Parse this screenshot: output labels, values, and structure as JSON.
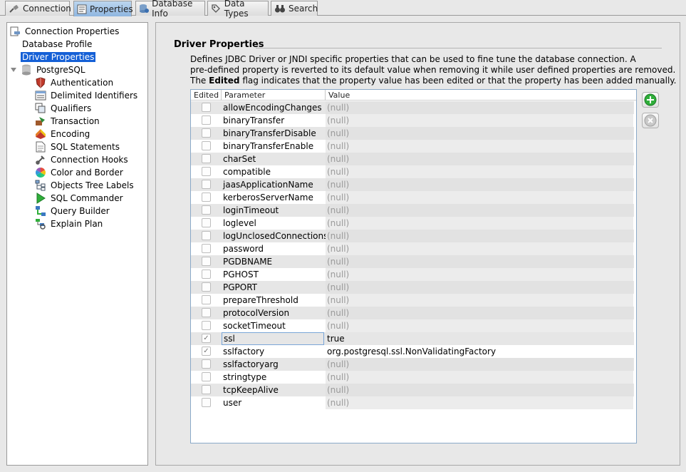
{
  "tabs": [
    {
      "label": "Connection",
      "icon": "plug-icon"
    },
    {
      "label": "Properties",
      "icon": "properties-icon"
    },
    {
      "label": "Database Info",
      "icon": "database-info-icon"
    },
    {
      "label": "Data Types",
      "icon": "data-types-icon"
    },
    {
      "label": "Search",
      "icon": "binoculars-icon"
    }
  ],
  "tree": {
    "root": "Connection Properties",
    "items": [
      {
        "label": "Database Profile"
      },
      {
        "label": "Driver Properties"
      },
      {
        "label": "PostgreSQL"
      },
      {
        "label": "Authentication",
        "icon": "shield-icon"
      },
      {
        "label": "Delimited Identifiers",
        "icon": "identifiers-icon"
      },
      {
        "label": "Qualifiers",
        "icon": "qualifiers-icon"
      },
      {
        "label": "Transaction",
        "icon": "transaction-icon"
      },
      {
        "label": "Encoding",
        "icon": "encoding-icon"
      },
      {
        "label": "SQL Statements",
        "icon": "document-icon"
      },
      {
        "label": "Connection Hooks",
        "icon": "hook-icon"
      },
      {
        "label": "Color and Border",
        "icon": "color-wheel-icon"
      },
      {
        "label": "Objects Tree Labels",
        "icon": "tree-labels-icon"
      },
      {
        "label": "SQL Commander",
        "icon": "play-icon"
      },
      {
        "label": "Query Builder",
        "icon": "query-builder-icon"
      },
      {
        "label": "Explain Plan",
        "icon": "explain-plan-icon"
      }
    ]
  },
  "section": {
    "title": "Driver Properties",
    "desc_line1": "Defines JDBC Driver or JNDI specific properties that can be used to fine tune the database connection. A",
    "desc_line2": "pre-defined property is reverted to its default value when removing it while user defined properties are removed.",
    "desc_line3_pre": "The ",
    "desc_line3_bold": "Edited",
    "desc_line3_post": " flag indicates that the property value has been edited or that the property has been added manually."
  },
  "table": {
    "headers": {
      "edited": "Edited",
      "parameter": "Parameter",
      "value": "Value"
    },
    "rows": [
      {
        "param": "allowEncodingChanges",
        "value": "(null)",
        "edited": false
      },
      {
        "param": "binaryTransfer",
        "value": "(null)",
        "edited": false
      },
      {
        "param": "binaryTransferDisable",
        "value": "(null)",
        "edited": false
      },
      {
        "param": "binaryTransferEnable",
        "value": "(null)",
        "edited": false
      },
      {
        "param": "charSet",
        "value": "(null)",
        "edited": false
      },
      {
        "param": "compatible",
        "value": "(null)",
        "edited": false
      },
      {
        "param": "jaasApplicationName",
        "value": "(null)",
        "edited": false
      },
      {
        "param": "kerberosServerName",
        "value": "(null)",
        "edited": false
      },
      {
        "param": "loginTimeout",
        "value": "(null)",
        "edited": false
      },
      {
        "param": "loglevel",
        "value": "(null)",
        "edited": false
      },
      {
        "param": "logUnclosedConnections",
        "value": "(null)",
        "edited": false
      },
      {
        "param": "password",
        "value": "(null)",
        "edited": false
      },
      {
        "param": "PGDBNAME",
        "value": "(null)",
        "edited": false
      },
      {
        "param": "PGHOST",
        "value": "(null)",
        "edited": false
      },
      {
        "param": "PGPORT",
        "value": "(null)",
        "edited": false
      },
      {
        "param": "prepareThreshold",
        "value": "(null)",
        "edited": false
      },
      {
        "param": "protocolVersion",
        "value": "(null)",
        "edited": false
      },
      {
        "param": "socketTimeout",
        "value": "(null)",
        "edited": false
      },
      {
        "param": "ssl",
        "value": "true",
        "edited": true
      },
      {
        "param": "sslfactory",
        "value": "org.postgresql.ssl.NonValidatingFactory",
        "edited": true
      },
      {
        "param": "sslfactoryarg",
        "value": "(null)",
        "edited": false
      },
      {
        "param": "stringtype",
        "value": "(null)",
        "edited": false
      },
      {
        "param": "tcpKeepAlive",
        "value": "(null)",
        "edited": false
      },
      {
        "param": "user",
        "value": "(null)",
        "edited": false
      }
    ]
  },
  "buttons": {
    "add": "add-icon",
    "remove": "remove-icon"
  },
  "colors": {
    "selection": "#1560d6",
    "active_tab": "#8fb6e0",
    "add_green": "#2fae3a"
  }
}
